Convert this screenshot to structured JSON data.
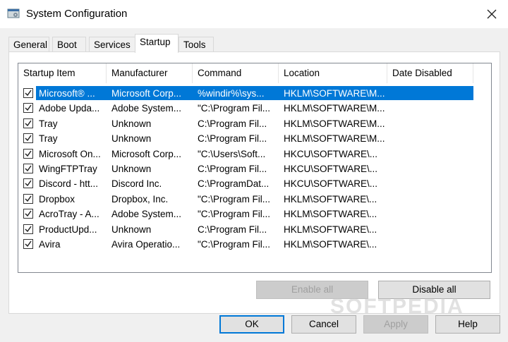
{
  "window": {
    "title": "System Configuration",
    "icon": "msconfig-icon",
    "close_icon": "close-icon"
  },
  "tabs": [
    {
      "label": "General",
      "active": false
    },
    {
      "label": "Boot",
      "active": false
    },
    {
      "label": "Services",
      "active": false
    },
    {
      "label": "Startup",
      "active": true
    },
    {
      "label": "Tools",
      "active": false
    }
  ],
  "list": {
    "columns": [
      "Startup Item",
      "Manufacturer",
      "Command",
      "Location",
      "Date Disabled"
    ],
    "rows": [
      {
        "item": "Microsoft® ...",
        "manufacturer": "Microsoft Corp...",
        "command": "%windir%\\sys...",
        "location": "HKLM\\SOFTWARE\\M...",
        "date_disabled": "",
        "checked": true,
        "selected": true
      },
      {
        "item": "Adobe Upda...",
        "manufacturer": "Adobe System...",
        "command": "\"C:\\Program Fil...",
        "location": "HKLM\\SOFTWARE\\M...",
        "date_disabled": "",
        "checked": true,
        "selected": false
      },
      {
        "item": "Tray",
        "manufacturer": "Unknown",
        "command": "C:\\Program Fil...",
        "location": "HKLM\\SOFTWARE\\M...",
        "date_disabled": "",
        "checked": true,
        "selected": false
      },
      {
        "item": "Tray",
        "manufacturer": "Unknown",
        "command": "C:\\Program Fil...",
        "location": "HKLM\\SOFTWARE\\M...",
        "date_disabled": "",
        "checked": true,
        "selected": false
      },
      {
        "item": "Microsoft On...",
        "manufacturer": "Microsoft Corp...",
        "command": "\"C:\\Users\\Soft...",
        "location": "HKCU\\SOFTWARE\\...",
        "date_disabled": "",
        "checked": true,
        "selected": false
      },
      {
        "item": "WingFTPTray",
        "manufacturer": "Unknown",
        "command": "C:\\Program Fil...",
        "location": "HKCU\\SOFTWARE\\...",
        "date_disabled": "",
        "checked": true,
        "selected": false
      },
      {
        "item": "Discord - htt...",
        "manufacturer": "Discord Inc.",
        "command": "C:\\ProgramDat...",
        "location": "HKCU\\SOFTWARE\\...",
        "date_disabled": "",
        "checked": true,
        "selected": false
      },
      {
        "item": "Dropbox",
        "manufacturer": "Dropbox, Inc.",
        "command": "\"C:\\Program Fil...",
        "location": "HKLM\\SOFTWARE\\...",
        "date_disabled": "",
        "checked": true,
        "selected": false
      },
      {
        "item": "AcroTray - A...",
        "manufacturer": "Adobe System...",
        "command": "\"C:\\Program Fil...",
        "location": "HKLM\\SOFTWARE\\...",
        "date_disabled": "",
        "checked": true,
        "selected": false
      },
      {
        "item": "ProductUpd...",
        "manufacturer": "Unknown",
        "command": "C:\\Program Fil...",
        "location": "HKLM\\SOFTWARE\\...",
        "date_disabled": "",
        "checked": true,
        "selected": false
      },
      {
        "item": "Avira",
        "manufacturer": "Avira Operatio...",
        "command": "\"C:\\Program Fil...",
        "location": "HKLM\\SOFTWARE\\...",
        "date_disabled": "",
        "checked": true,
        "selected": false
      }
    ]
  },
  "panel_buttons": {
    "enable_all": "Enable all",
    "disable_all": "Disable all"
  },
  "dialog_buttons": {
    "ok": "OK",
    "cancel": "Cancel",
    "apply": "Apply",
    "help": "Help"
  },
  "watermark": "SOFTPEDIA",
  "colors": {
    "selection": "#0078d7",
    "default_button_border": "#0078d7",
    "window_bg": "#f0f0f0"
  }
}
